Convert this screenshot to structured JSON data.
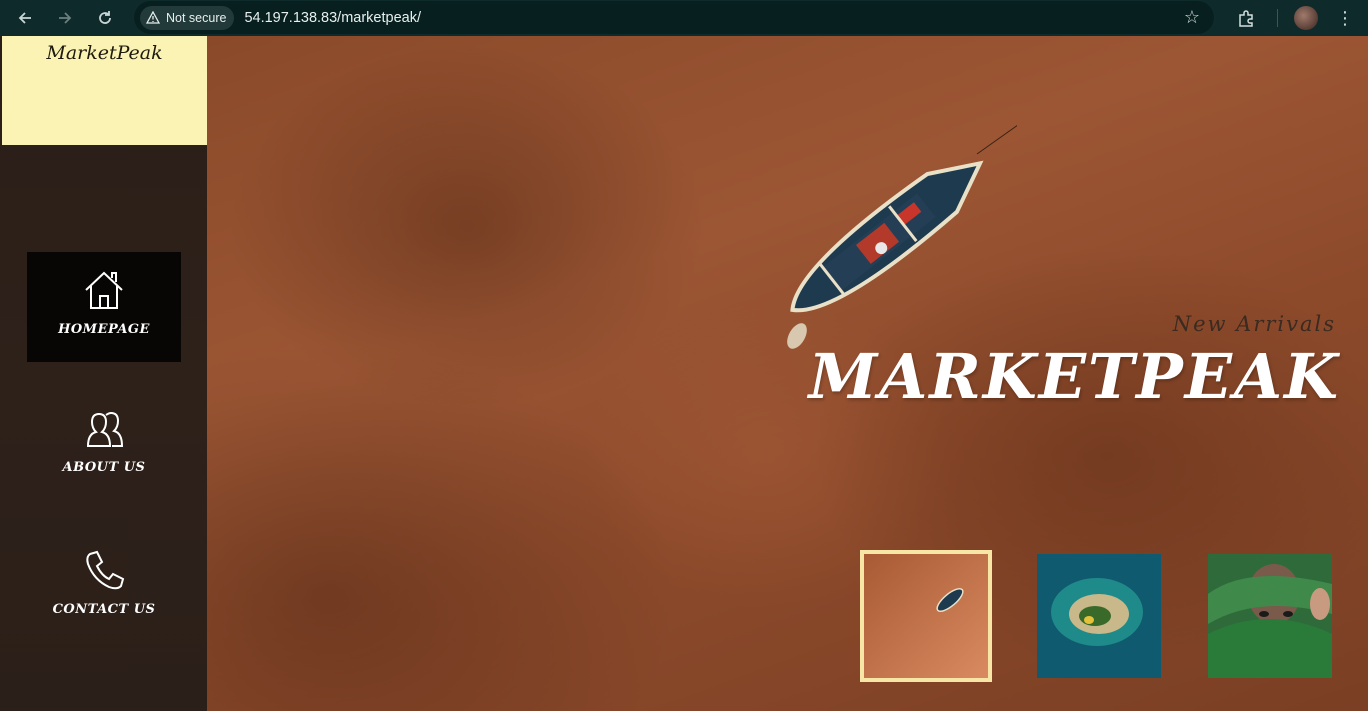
{
  "browser": {
    "security_label": "Not secure",
    "url": "54.197.138.83/marketpeak/"
  },
  "sidebar": {
    "logo": "MarketPeak",
    "items": [
      {
        "label": "HOMEPAGE",
        "icon": "home-icon"
      },
      {
        "label": "ABOUT US",
        "icon": "users-icon"
      },
      {
        "label": "CONTACT US",
        "icon": "phone-icon"
      }
    ]
  },
  "hero": {
    "tagline": "New Arrivals",
    "headline": "MARKETPEAK"
  },
  "colors": {
    "logo_bg": "#faf3b4",
    "sidebar_bg": "#2b1f19",
    "active_nav_bg": "#080605",
    "thumb_border": "#f7e6a6",
    "hero_bg": "#8d4a2b"
  }
}
